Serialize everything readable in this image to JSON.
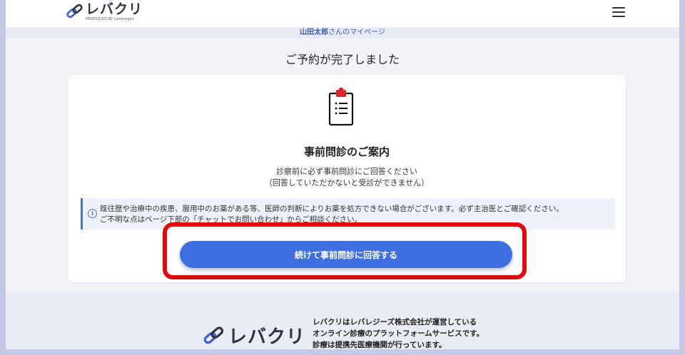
{
  "header": {
    "logo_text": "レバクリ",
    "logo_sub": "PRODUCED BY Leverages"
  },
  "greeting": {
    "name": "山田太郎",
    "suffix": "さんのマイページ"
  },
  "page_title": "ご予約が完了しました",
  "card": {
    "heading": "事前問診のご案内",
    "desc_line1": "診察前に必ず事前問診にご回答ください",
    "desc_line2": "（回答していただかないと受診ができません）",
    "notice_line1": "既往歴や治療中の疾患、服用中のお薬がある等、医師の判断によりお薬を処方できない場合がございます。必ず主治医とご確認ください。",
    "notice_line2": "ご不明な点はページ下部の「チャットでお問い合わせ」からご相談ください。",
    "cta_label": "続けて事前問診に回答する"
  },
  "footer": {
    "logo_text": "レバクリ",
    "line1": "レバクリはレバレジーズ株式会社が運営している",
    "line2": "オンライン診療のプラットフォームサービスです。",
    "line3": "診療は提携先医療機関が行っています。"
  },
  "colors": {
    "accent": "#3e6ee0",
    "highlight": "#e0090e",
    "logo_blue": "#3b5bd9"
  }
}
